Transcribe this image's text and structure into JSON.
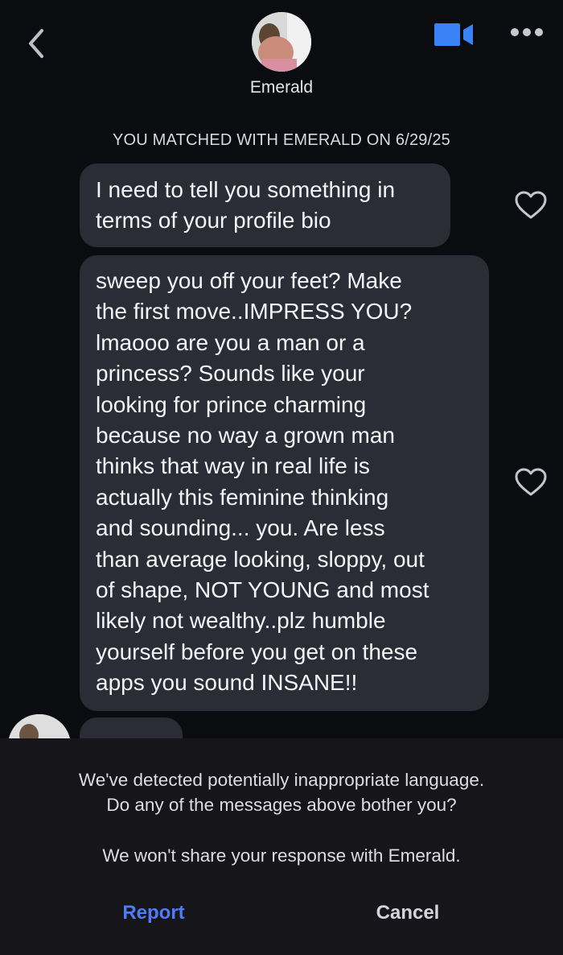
{
  "header": {
    "contact_name": "Emerald",
    "back_icon": "chevron-left-icon",
    "video_icon": "video-camera-icon",
    "more_icon": "more-horizontal-icon"
  },
  "match_banner": "YOU MATCHED WITH EMERALD ON 6/29/25",
  "messages": [
    {
      "text": "I need to tell you something in\nterms of your profile bio",
      "like_icon": "heart-outline-icon"
    },
    {
      "text": "sweep you off your feet? Make\nthe first move..IMPRESS YOU?\nlmaooo are you a man or a\nprincess?  Sounds like your\nlooking for prince charming\nbecause no way a grown man\nthinks that way in real life is\nactually this feminine thinking\nand sounding... you. Are less\nthan average looking, sloppy, out\nof shape, NOT YOUNG  and most\nlikely not wealthy..plz humble\nyourself before you get on these\napps you sound INSANE!!",
      "like_icon": "heart-outline-icon"
    }
  ],
  "prompt": {
    "line1": "We've detected potentially inappropriate language.",
    "line2": "Do any of the messages above bother you?",
    "line3": "We won't share your response with Emerald.",
    "report_label": "Report",
    "cancel_label": "Cancel"
  },
  "colors": {
    "background": "#0b0c10",
    "bubble": "#2a2c36",
    "accent_blue": "#4f7bf7",
    "video_icon": "#3b82f6"
  }
}
